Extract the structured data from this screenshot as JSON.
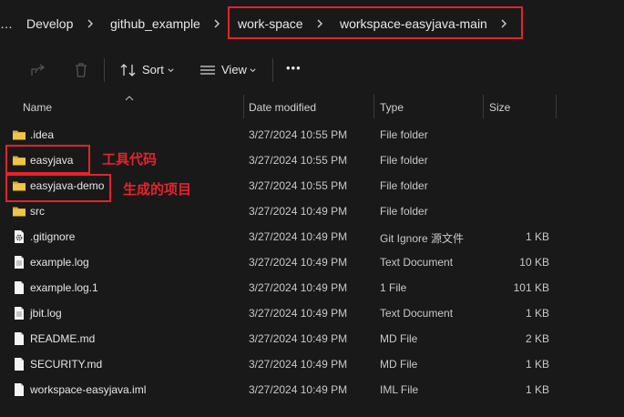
{
  "breadcrumb": {
    "items": [
      "Develop",
      "github_example",
      "work-space",
      "workspace-easyjava-main"
    ]
  },
  "toolbar": {
    "sort_label": "Sort",
    "view_label": "View",
    "more_label": "•••"
  },
  "columns": {
    "name": "Name",
    "date": "Date modified",
    "type": "Type",
    "size": "Size"
  },
  "files": [
    {
      "name": ".idea",
      "date": "3/27/2024 10:55 PM",
      "type": "File folder",
      "size": "",
      "icon": "folder-icon"
    },
    {
      "name": "easyjava",
      "date": "3/27/2024 10:55 PM",
      "type": "File folder",
      "size": "",
      "icon": "folder-icon"
    },
    {
      "name": "easyjava-demo",
      "date": "3/27/2024 10:55 PM",
      "type": "File folder",
      "size": "",
      "icon": "folder-icon"
    },
    {
      "name": "src",
      "date": "3/27/2024 10:49 PM",
      "type": "File folder",
      "size": "",
      "icon": "folder-icon"
    },
    {
      "name": ".gitignore",
      "date": "3/27/2024 10:49 PM",
      "type": "Git Ignore 源文件",
      "size": "1 KB",
      "icon": "gear-file-icon"
    },
    {
      "name": "example.log",
      "date": "3/27/2024 10:49 PM",
      "type": "Text Document",
      "size": "10 KB",
      "icon": "document-icon"
    },
    {
      "name": "example.log.1",
      "date": "3/27/2024 10:49 PM",
      "type": "1 File",
      "size": "101 KB",
      "icon": "file-icon"
    },
    {
      "name": "jbit.log",
      "date": "3/27/2024 10:49 PM",
      "type": "Text Document",
      "size": "1 KB",
      "icon": "document-icon"
    },
    {
      "name": "README.md",
      "date": "3/27/2024 10:49 PM",
      "type": "MD File",
      "size": "2 KB",
      "icon": "file-icon"
    },
    {
      "name": "SECURITY.md",
      "date": "3/27/2024 10:49 PM",
      "type": "MD File",
      "size": "1 KB",
      "icon": "file-icon"
    },
    {
      "name": "workspace-easyjava.iml",
      "date": "3/27/2024 10:49 PM",
      "type": "IML File",
      "size": "1 KB",
      "icon": "file-icon"
    }
  ],
  "annotations": {
    "easyjava_note": "工具代码",
    "demo_note": "生成的项目"
  },
  "colors": {
    "background": "#191919",
    "highlight": "#e5232b",
    "folder": "#f0c040"
  }
}
